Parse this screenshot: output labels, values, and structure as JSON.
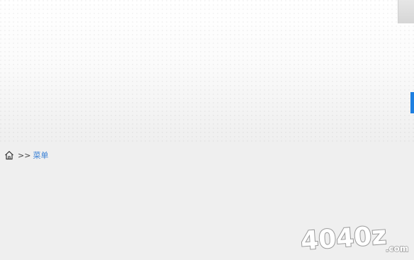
{
  "breadcrumb": {
    "separator": ">>",
    "current": "菜单"
  },
  "watermark": {
    "text": "4040z",
    "suffix": ".com"
  },
  "colors": {
    "accent": "#1e7fe0",
    "link": "#3b82d6"
  },
  "icons": [
    "home-icon"
  ]
}
